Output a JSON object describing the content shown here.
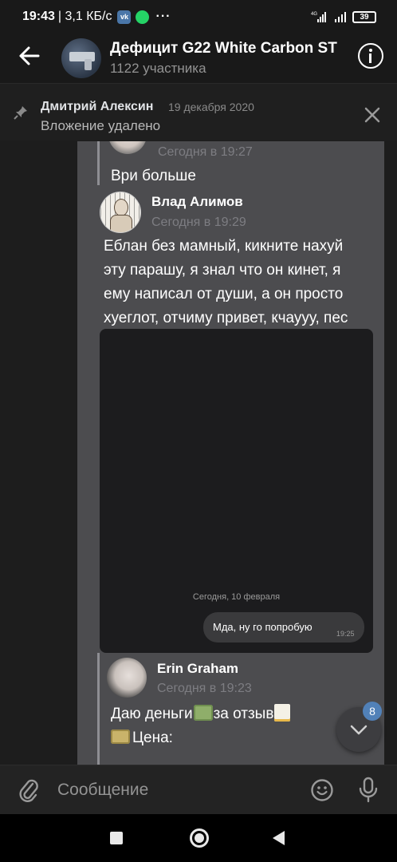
{
  "statusbar": {
    "time": "19:43",
    "speed": "| 3,1 КБ/с",
    "network": "4G",
    "battery": "39"
  },
  "header": {
    "title": "Дефицит G22 White Carbon ST",
    "subtitle": "1122 участника"
  },
  "pinned": {
    "author": "Дмитрий Алексин",
    "date": "19 декабря 2020",
    "text": "Вложение удалено"
  },
  "messages": {
    "quoted_time": "Сегодня в 19:27",
    "quoted_text": "Ври больше",
    "forward": {
      "author": "Влад Алимов",
      "time": "Сегодня в 19:29",
      "text_lines": [
        "Еблан без мамный, кикните нахуй",
        "эту парашу, я знал что он кинет, я",
        "ему написал от души, а он просто",
        "хуеглот, отчиму привет, кчаууу, пес"
      ]
    },
    "screenshot": {
      "date_label": "Сегодня, 10 февраля",
      "bubble_text": "Мда, ну го попробую",
      "bubble_time": "19:25"
    },
    "erin": {
      "author": "Erin Graham",
      "time": "Сегодня в 19:23",
      "line1_a": "Даю деньги",
      "line1_b": "за отзыв",
      "line2": "Цена:"
    }
  },
  "scroll_badge": "8",
  "composer": {
    "placeholder": "Сообщение"
  }
}
